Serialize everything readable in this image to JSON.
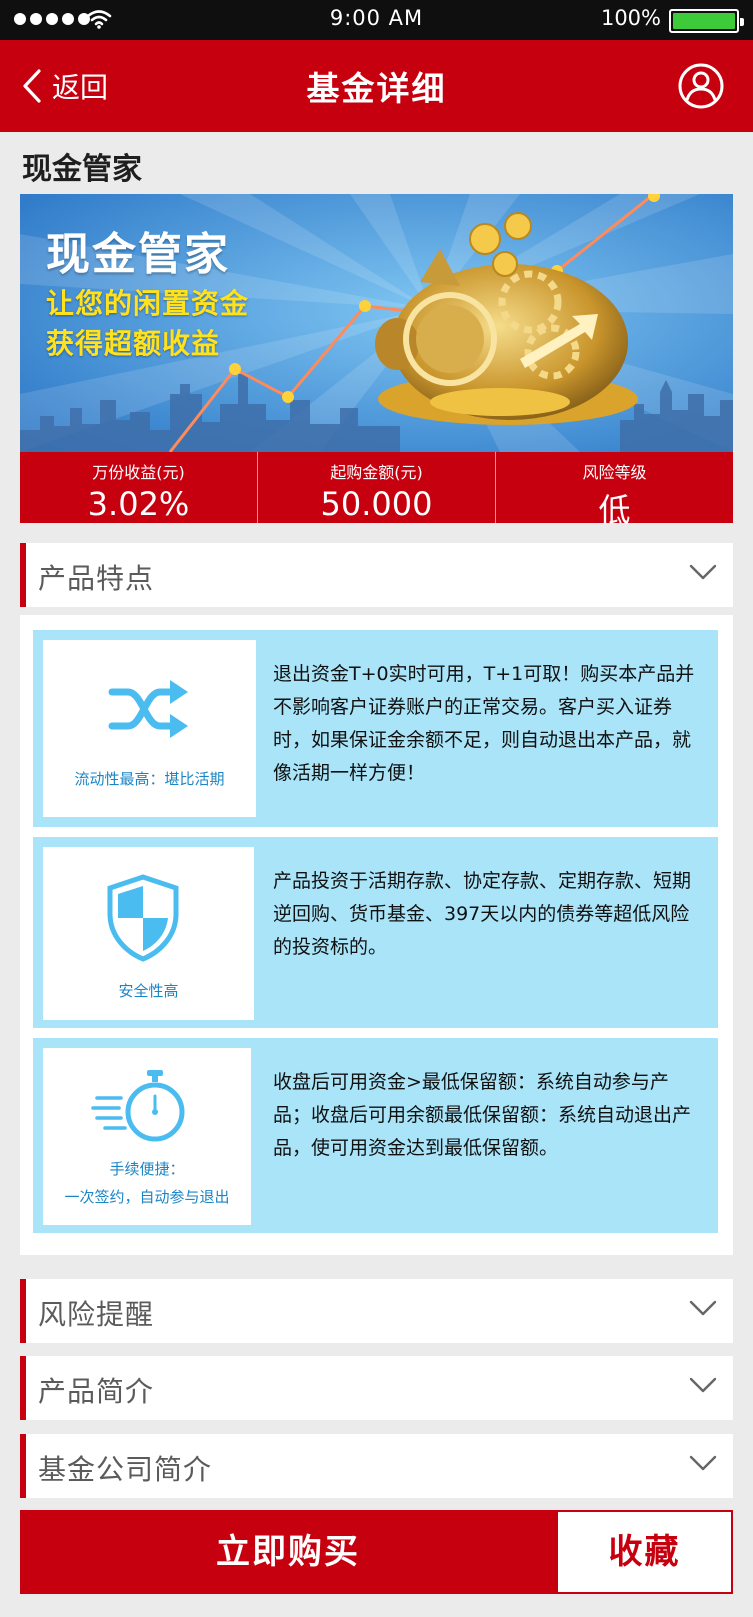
{
  "status_bar": {
    "time": "9:00  AM",
    "battery_percent": "100%",
    "battery_level": 1.0,
    "signal_icon": "signal-dots-icon",
    "wifi_icon": "wifi-icon",
    "battery_icon": "battery-icon"
  },
  "nav": {
    "back_label": "返回",
    "title": "基金详细",
    "back_icon": "chevron-left-icon",
    "user_icon": "user-icon"
  },
  "page_title": "现金管家",
  "banner": {
    "title": "现金管家",
    "line1": "让您的闲置资金",
    "line2": "获得超额收益"
  },
  "stats": [
    {
      "label": "万份收益(元)",
      "value": "3.02%"
    },
    {
      "label": "起购金额(元)",
      "value": "50.000"
    },
    {
      "label": "风险等级",
      "value": "低"
    }
  ],
  "sections": {
    "features_header": "产品特点",
    "risk_header": "风险提醒",
    "intro_header": "产品简介",
    "company_header": "基金公司简介"
  },
  "features": [
    {
      "icon": "shuffle-arrows-icon",
      "label": "流动性最高：堪比活期",
      "label_line2": "",
      "text": "退出资金T+0实时可用，T+1可取！购买本产品并不影响客户证券账户的正常交易。客户买入证券时，如果保证金余额不足，则自动退出本产品，就像活期一样方便！"
    },
    {
      "icon": "shield-icon",
      "label": "安全性高",
      "label_line2": "",
      "text": "产品投资于活期存款、协定存款、定期存款、短期逆回购、货币基金、397天以内的债券等超低风险的投资标的。"
    },
    {
      "icon": "stopwatch-icon",
      "label": "手续便捷：",
      "label_line2": "一次签约，自动参与退出",
      "text": "收盘后可用资金>最低保留额：系统自动参与产品；收盘后可用余额最低保留额：系统自动退出产品，使可用资金达到最低保留额。"
    }
  ],
  "actions": {
    "buy_label": "立即购买",
    "favorite_label": "收藏"
  },
  "colors": {
    "brand_red": "#c7000f",
    "card_blue": "#a9e4f8",
    "icon_blue": "#4bbcef",
    "icon_label_blue": "#1b86c6",
    "banner_yellow": "#ffe11c",
    "battery_green": "#3ecb3a"
  }
}
